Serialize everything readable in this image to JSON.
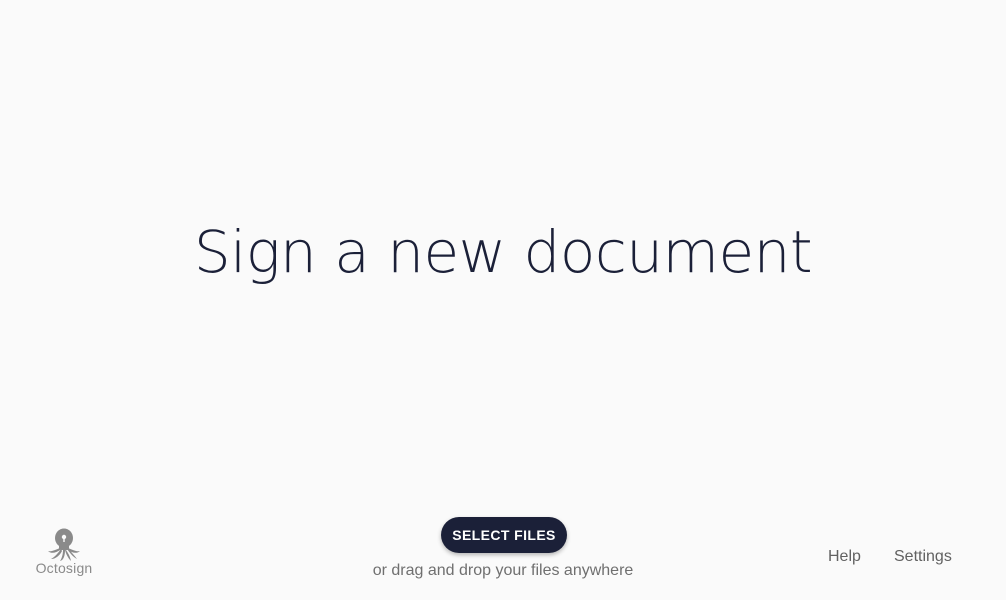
{
  "main": {
    "title": "Sign a new document"
  },
  "upload": {
    "select_label": "SELECT FILES",
    "hint": "or drag and drop your files anywhere"
  },
  "brand": {
    "name": "Octosign",
    "icon": "octopus-icon"
  },
  "nav": {
    "help_label": "Help",
    "settings_label": "Settings"
  },
  "colors": {
    "background": "#fafafa",
    "primary": "#1b2038",
    "muted_text": "#6f6f6f",
    "logo_gray": "#8a8a8a"
  }
}
